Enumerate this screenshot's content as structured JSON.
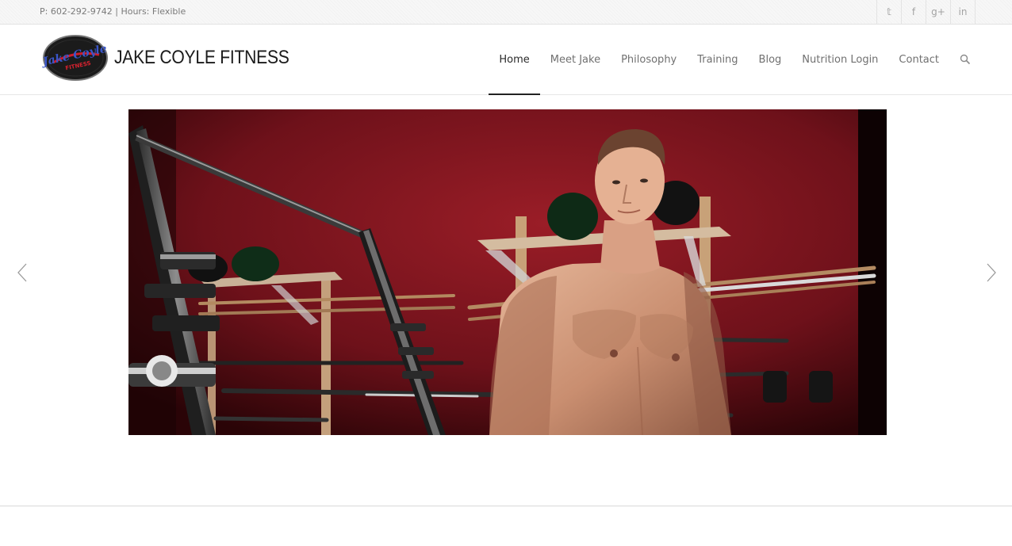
{
  "topbar": {
    "contact": "P: 602-292-9742 | Hours: Flexible",
    "social": [
      {
        "icon": "twitter-icon",
        "glyph": "𝕥"
      },
      {
        "icon": "facebook-icon",
        "glyph": "f"
      },
      {
        "icon": "google-plus-icon",
        "glyph": "g+"
      },
      {
        "icon": "linkedin-icon",
        "glyph": "in"
      }
    ]
  },
  "header": {
    "logo": {
      "line1": "Jake Coyle",
      "line2": "FITNESS"
    },
    "brand": "JAKE COYLE FITNESS"
  },
  "nav": {
    "items": [
      "Home",
      "Meet Jake",
      "Philosophy",
      "Training",
      "Blog",
      "Nutrition Login",
      "Contact"
    ],
    "active_index": 0,
    "search_icon": "search-icon"
  },
  "slider": {
    "prev_icon": "chevron-left-icon",
    "next_icon": "chevron-right-icon"
  },
  "colors": {
    "wall": "#7a1520",
    "nav_active": "#2a2a2a",
    "nav_text": "#707070"
  }
}
